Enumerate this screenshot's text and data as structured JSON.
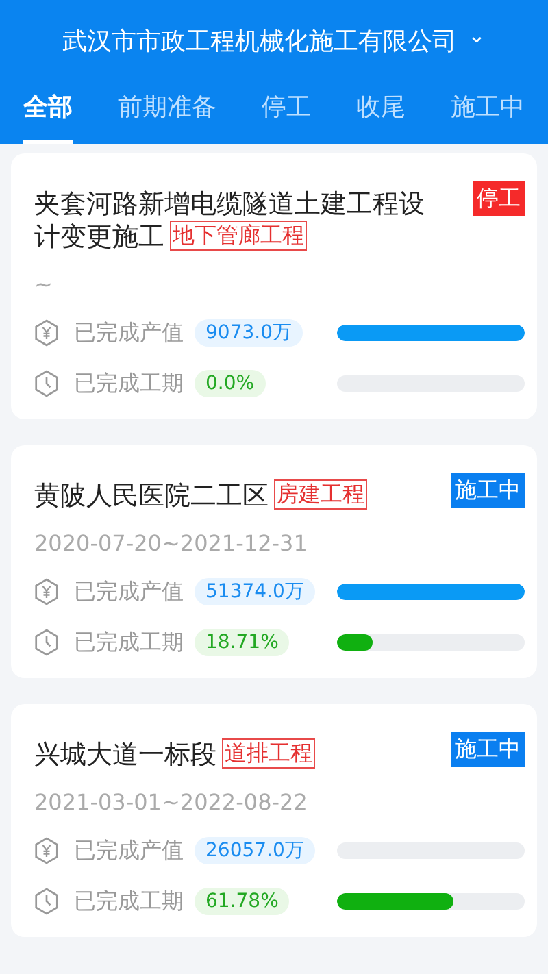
{
  "header": {
    "title": "武汉市市政工程机械化施工有限公司",
    "dropdown_icon": "⌄"
  },
  "tabs": [
    {
      "label": "全部",
      "selected": true
    },
    {
      "label": "前期准备",
      "selected": false
    },
    {
      "label": "停工",
      "selected": false
    },
    {
      "label": "收尾",
      "selected": false
    },
    {
      "label": "施工中",
      "selected": false
    }
  ],
  "projects": [
    {
      "name": "夹套河路新增电缆隧道土建工程设计变更施工",
      "category": "地下管廊工程",
      "status": {
        "label": "停工",
        "color": "#f52a2a"
      },
      "dates": "~",
      "metrics": [
        {
          "kind": "value",
          "label": "已完成产值",
          "reading": "9073.0万",
          "level": 1
        },
        {
          "kind": "period",
          "label": "已完成工期",
          "reading": "0.0%",
          "level": 0
        }
      ]
    },
    {
      "name": "黄陂人民医院二工区",
      "category": "房建工程",
      "status": {
        "label": "施工中",
        "color": "#0a7ff0"
      },
      "dates": "2020-07-20~2021-12-31",
      "metrics": [
        {
          "kind": "value",
          "label": "已完成产值",
          "reading": "51374.0万",
          "level": 1
        },
        {
          "kind": "period",
          "label": "已完成工期",
          "reading": "18.71%",
          "level": 0.1871
        }
      ]
    },
    {
      "name": "兴城大道一标段",
      "category": "道排工程",
      "status": {
        "label": "施工中",
        "color": "#0a7ff0"
      },
      "dates": "2021-03-01~2022-08-22",
      "metrics": [
        {
          "kind": "value",
          "label": "已完成产值",
          "reading": "26057.0万",
          "level": 0
        },
        {
          "kind": "period",
          "label": "已完成工期",
          "reading": "61.78%",
          "level": 0.6178
        }
      ]
    }
  ]
}
